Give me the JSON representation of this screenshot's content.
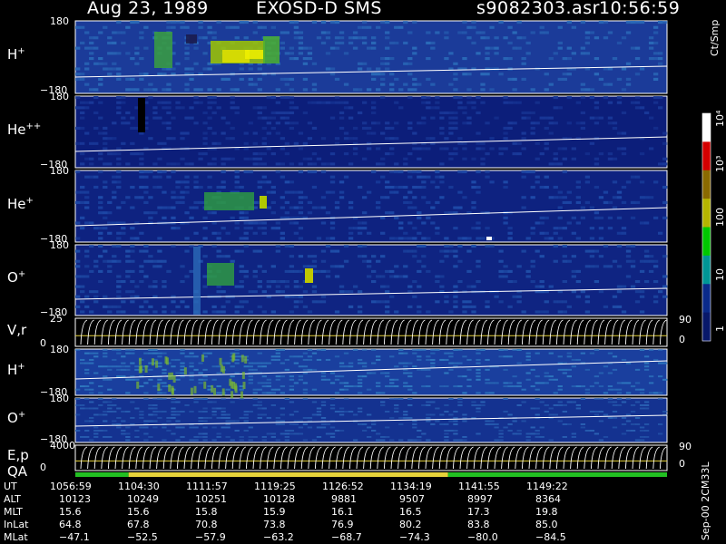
{
  "header": {
    "date": "Aug 23, 1989",
    "mission": "EXOSD-D SMS",
    "filename": "s9082303.asr",
    "time": "10:56:59"
  },
  "colorbar": {
    "unit_label": "Ct/Smp",
    "tick_labels": [
      "10⁴",
      "10³",
      "100",
      "10",
      "1"
    ],
    "colors": [
      "#ffffff",
      "#d40000",
      "#8a6a00",
      "#b4b400",
      "#00c800",
      "#009696",
      "#0a2a8a",
      "#08186a"
    ]
  },
  "panels": [
    {
      "id": "H+",
      "label": "H",
      "sup": "+",
      "ymax": "180",
      "ymin": "−180",
      "base_color": "#1b3b99",
      "speckle": "#2a6ab8",
      "right_ticks": []
    },
    {
      "id": "He++",
      "label": "He",
      "sup": "++",
      "ymax": "180",
      "ymin": "−180",
      "base_color": "#0c1e7a",
      "speckle": "#1a3a9a",
      "right_ticks": []
    },
    {
      "id": "He+",
      "label": "He",
      "sup": "+",
      "ymax": "180",
      "ymin": "−180",
      "base_color": "#0e2280",
      "speckle": "#1e4aa8",
      "right_ticks": []
    },
    {
      "id": "O+",
      "label": "O",
      "sup": "+",
      "ymax": "180",
      "ymin": "−180",
      "base_color": "#0f2482",
      "speckle": "#2050aa",
      "right_ticks": []
    },
    {
      "id": "V,r",
      "label": "V,r",
      "sup": "",
      "ymax": "25",
      "ymin": "0",
      "base_color": "#000000",
      "speckle": "#000000",
      "right_ticks": [
        "90",
        "0"
      ]
    },
    {
      "id": "H+2",
      "label": "H",
      "sup": "+",
      "ymax": "180",
      "ymin": "−180",
      "base_color": "#1a3f9e",
      "speckle": "#2f7ac0",
      "right_ticks": []
    },
    {
      "id": "O+2",
      "label": "O",
      "sup": "+",
      "ymax": "180",
      "ymin": "−180",
      "base_color": "#143290",
      "speckle": "#2a62b4",
      "right_ticks": []
    },
    {
      "id": "E,p",
      "label": "E,p",
      "sup": "",
      "ymax": "4000",
      "ymin": "0",
      "base_color": "#000000",
      "speckle": "#000000",
      "right_ticks": [
        "90",
        "0"
      ]
    }
  ],
  "qa": {
    "label": "QA",
    "segments": [
      {
        "from": 0.0,
        "to": 0.09,
        "color": "#22c022"
      },
      {
        "from": 0.09,
        "to": 0.63,
        "color": "#e6d23a"
      },
      {
        "from": 0.63,
        "to": 1.0,
        "color": "#22c022"
      }
    ]
  },
  "footer": {
    "rows": [
      {
        "label": "UT",
        "values": [
          "1056:59",
          "1104:30",
          "1111:57",
          "1119:25",
          "1126:52",
          "1134:19",
          "1141:55",
          "1149:22"
        ]
      },
      {
        "label": "ALT",
        "values": [
          "10123",
          "10249",
          "10251",
          "10128",
          "9881",
          "9507",
          "8997",
          "8364"
        ]
      },
      {
        "label": "MLT",
        "values": [
          "15.6",
          "15.6",
          "15.8",
          "15.9",
          "16.1",
          "16.5",
          "17.3",
          "19.8"
        ]
      },
      {
        "label": "InLat",
        "values": [
          "64.8",
          "67.8",
          "70.8",
          "73.8",
          "76.9",
          "80.2",
          "83.8",
          "85.0"
        ]
      },
      {
        "label": "MLat",
        "values": [
          "−47.1",
          "−52.5",
          "−57.9",
          "−63.2",
          "−68.7",
          "−74.3",
          "−80.0",
          "−84.5"
        ]
      }
    ],
    "version": "Sep-00 2CM33L"
  },
  "chart_data": {
    "type": "heatmap",
    "title": "Aug 23, 1989   EXOSD-D SMS",
    "x_tick_labels": [
      "1056:59",
      "1104:30",
      "1111:57",
      "1119:25",
      "1126:52",
      "1134:19",
      "1141:55",
      "1149:22"
    ],
    "colorbar_unit": "Ct/Smp",
    "colorbar_scale": "log",
    "colorbar_range": [
      1,
      10000
    ],
    "panels": [
      "H+",
      "He++",
      "He+",
      "O+",
      "V,r",
      "H+",
      "O+",
      "E,p"
    ]
  }
}
